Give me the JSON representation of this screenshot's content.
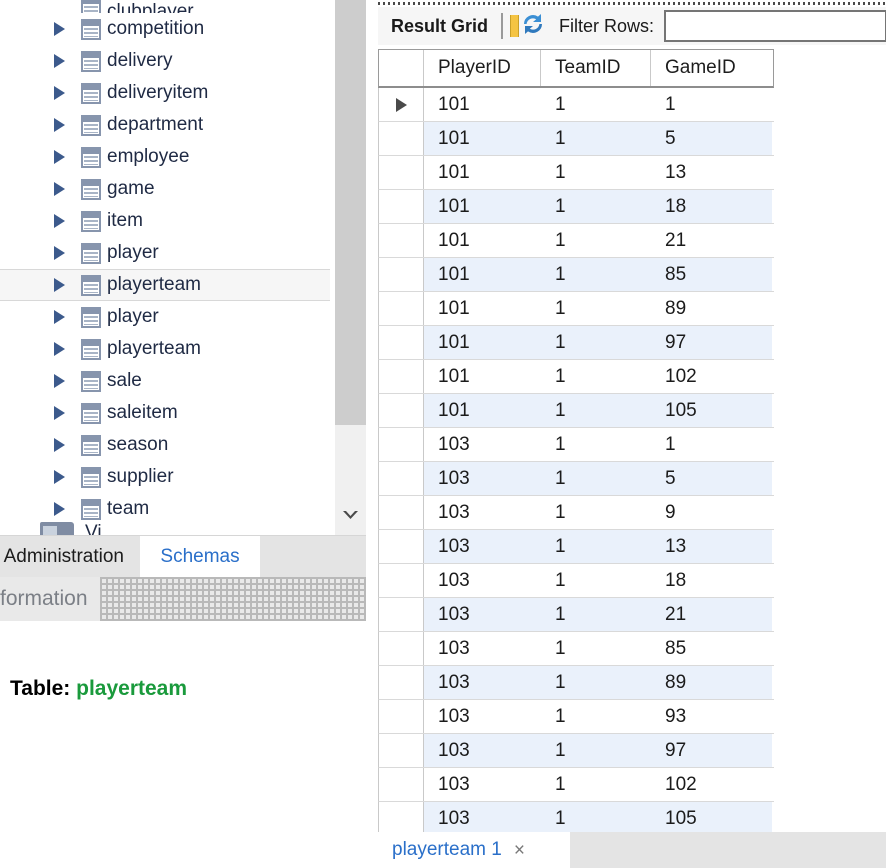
{
  "sidebar": {
    "tree_items": [
      {
        "label": "clubplayer",
        "icon": "table-icon",
        "clipped": true,
        "selected": false
      },
      {
        "label": "competition",
        "icon": "table-icon",
        "clipped": false,
        "selected": false
      },
      {
        "label": "delivery",
        "icon": "table-icon",
        "clipped": false,
        "selected": false
      },
      {
        "label": "deliveryitem",
        "icon": "table-icon",
        "clipped": false,
        "selected": false
      },
      {
        "label": "department",
        "icon": "table-icon",
        "clipped": false,
        "selected": false
      },
      {
        "label": "employee",
        "icon": "table-icon",
        "clipped": false,
        "selected": false
      },
      {
        "label": "game",
        "icon": "table-icon",
        "clipped": false,
        "selected": false
      },
      {
        "label": "item",
        "icon": "table-icon",
        "clipped": false,
        "selected": false
      },
      {
        "label": "player",
        "icon": "table-icon",
        "clipped": false,
        "selected": false
      },
      {
        "label": "playerteam",
        "icon": "table-icon",
        "clipped": false,
        "selected": true
      },
      {
        "label": "player",
        "icon": "table-icon",
        "clipped": false,
        "selected": false
      },
      {
        "label": "playerteam",
        "icon": "table-icon",
        "clipped": false,
        "selected": false
      },
      {
        "label": "sale",
        "icon": "table-icon",
        "clipped": false,
        "selected": false
      },
      {
        "label": "saleitem",
        "icon": "table-icon",
        "clipped": false,
        "selected": false
      },
      {
        "label": "season",
        "icon": "table-icon",
        "clipped": false,
        "selected": false
      },
      {
        "label": "supplier",
        "icon": "table-icon",
        "clipped": false,
        "selected": false
      },
      {
        "label": "team",
        "icon": "table-icon",
        "clipped": false,
        "selected": false
      }
    ],
    "folder_item": {
      "label": "Vi",
      "icon": "folder-icon"
    },
    "scroll_down_icon": "chevron-down-icon",
    "tabs": [
      {
        "label": "Administration",
        "active": false
      },
      {
        "label": "Schemas",
        "active": true
      }
    ],
    "information": {
      "header_label": "formation",
      "table_label": "Table:",
      "table_name": "playerteam"
    }
  },
  "result": {
    "toolbar": {
      "result_grid_label": "Result Grid",
      "grid_view_icon": "grid-view-icon",
      "refresh_icon": "refresh-icon",
      "filter_rows_label": "Filter Rows:",
      "filter_rows_value": "",
      "filter_rows_placeholder": ""
    },
    "grid": {
      "columns": [
        "",
        "PlayerID",
        "TeamID",
        "GameID"
      ],
      "rows": [
        {
          "marker": true,
          "PlayerID": "101",
          "TeamID": "1",
          "GameID": "1"
        },
        {
          "marker": false,
          "PlayerID": "101",
          "TeamID": "1",
          "GameID": "5"
        },
        {
          "marker": false,
          "PlayerID": "101",
          "TeamID": "1",
          "GameID": "13"
        },
        {
          "marker": false,
          "PlayerID": "101",
          "TeamID": "1",
          "GameID": "18"
        },
        {
          "marker": false,
          "PlayerID": "101",
          "TeamID": "1",
          "GameID": "21"
        },
        {
          "marker": false,
          "PlayerID": "101",
          "TeamID": "1",
          "GameID": "85"
        },
        {
          "marker": false,
          "PlayerID": "101",
          "TeamID": "1",
          "GameID": "89"
        },
        {
          "marker": false,
          "PlayerID": "101",
          "TeamID": "1",
          "GameID": "97"
        },
        {
          "marker": false,
          "PlayerID": "101",
          "TeamID": "1",
          "GameID": "102"
        },
        {
          "marker": false,
          "PlayerID": "101",
          "TeamID": "1",
          "GameID": "105"
        },
        {
          "marker": false,
          "PlayerID": "103",
          "TeamID": "1",
          "GameID": "1"
        },
        {
          "marker": false,
          "PlayerID": "103",
          "TeamID": "1",
          "GameID": "5"
        },
        {
          "marker": false,
          "PlayerID": "103",
          "TeamID": "1",
          "GameID": "9"
        },
        {
          "marker": false,
          "PlayerID": "103",
          "TeamID": "1",
          "GameID": "13"
        },
        {
          "marker": false,
          "PlayerID": "103",
          "TeamID": "1",
          "GameID": "18"
        },
        {
          "marker": false,
          "PlayerID": "103",
          "TeamID": "1",
          "GameID": "21"
        },
        {
          "marker": false,
          "PlayerID": "103",
          "TeamID": "1",
          "GameID": "85"
        },
        {
          "marker": false,
          "PlayerID": "103",
          "TeamID": "1",
          "GameID": "89"
        },
        {
          "marker": false,
          "PlayerID": "103",
          "TeamID": "1",
          "GameID": "93"
        },
        {
          "marker": false,
          "PlayerID": "103",
          "TeamID": "1",
          "GameID": "97"
        },
        {
          "marker": false,
          "PlayerID": "103",
          "TeamID": "1",
          "GameID": "102"
        },
        {
          "marker": false,
          "PlayerID": "103",
          "TeamID": "1",
          "GameID": "105"
        }
      ]
    },
    "tab": {
      "label": "playerteam 1",
      "close_icon": "close-icon",
      "close_glyph": "×"
    }
  },
  "colors": {
    "accent_blue": "#2a6fc9",
    "row_alt": "#eaf1fb",
    "table_name_green": "#1a9a3c",
    "tree_arrow": "#3c5a8c"
  }
}
